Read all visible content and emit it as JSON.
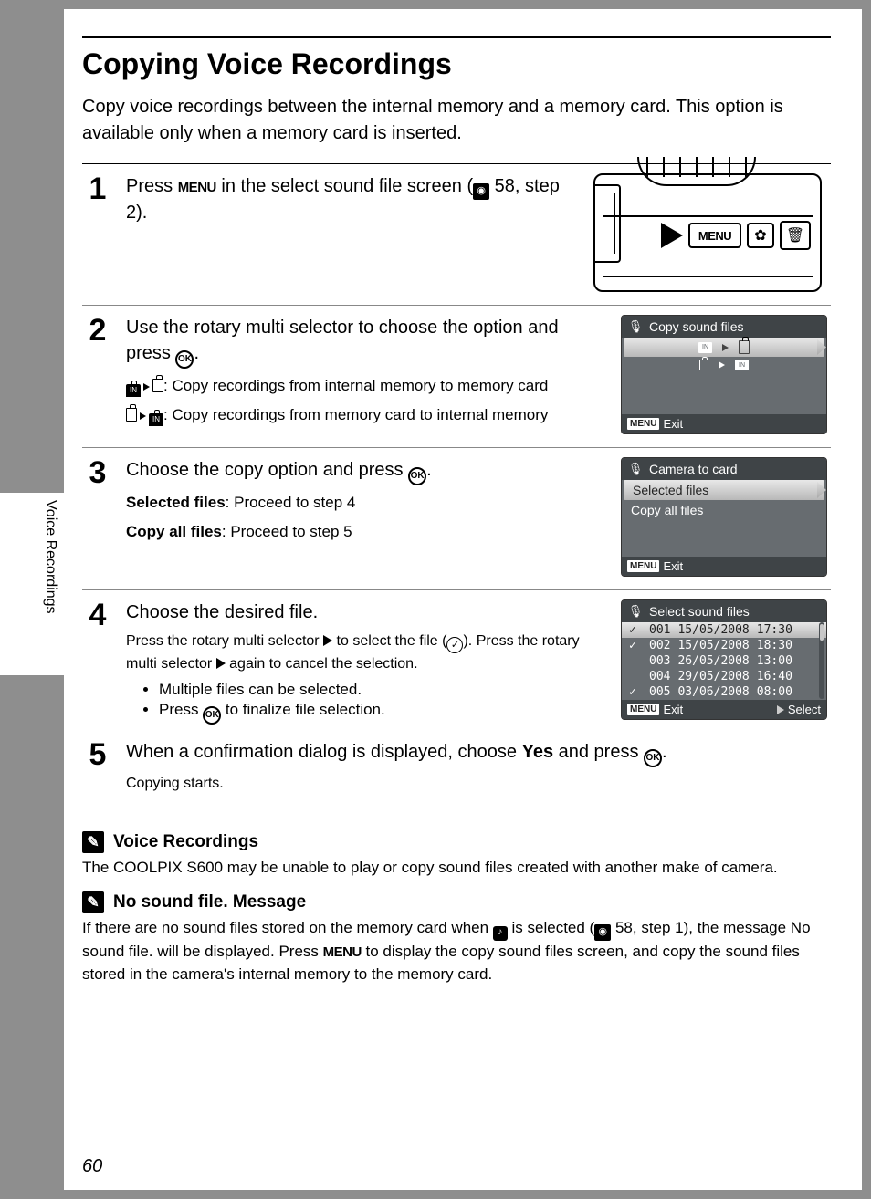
{
  "page_number": "60",
  "side_label": "Voice Recordings",
  "title": "Copying Voice Recordings",
  "intro": "Copy voice recordings between the internal memory and a memory card. This option is available only when a memory card is inserted.",
  "step1": {
    "text_a": "Press ",
    "text_b": " in the select sound file screen (",
    "ref": " 58, step 2).",
    "cam_menu": "MENU"
  },
  "step2": {
    "title_a": "Use the rotary multi selector to choose the option and press ",
    "title_b": ".",
    "sub1": ": Copy recordings from internal memory to memory card",
    "sub2": ": Copy recordings from memory card to internal memory",
    "lcd_title": "Copy sound files",
    "lcd_exit": "Exit"
  },
  "step3": {
    "title_a": "Choose the copy option and press ",
    "title_b": ".",
    "sel_label": "Selected files",
    "sel_text": ": Proceed to step 4",
    "all_label": "Copy all files",
    "all_text": ": Proceed to step 5",
    "lcd_title": "Camera to card",
    "lcd_opt1": "Selected files",
    "lcd_opt2": "Copy all files",
    "lcd_exit": "Exit"
  },
  "step4": {
    "title": "Choose the desired file.",
    "sub_a": "Press the rotary multi selector ",
    "sub_b": " to select the file (",
    "sub_c": "). Press the rotary multi selector ",
    "sub_d": " again to cancel the selection.",
    "bullet1": "Multiple files can be selected.",
    "bullet2_a": "Press ",
    "bullet2_b": " to finalize file selection.",
    "lcd_title": "Select sound files",
    "files": [
      {
        "chk": "✓",
        "n": "001",
        "d": "15/05/2008",
        "t": "17:30",
        "sel": true
      },
      {
        "chk": "✓",
        "n": "002",
        "d": "15/05/2008",
        "t": "18:30",
        "sel": false
      },
      {
        "chk": "",
        "n": "003",
        "d": "26/05/2008",
        "t": "13:00",
        "sel": false
      },
      {
        "chk": "",
        "n": "004",
        "d": "29/05/2008",
        "t": "16:40",
        "sel": false
      },
      {
        "chk": "✓",
        "n": "005",
        "d": "03/06/2008",
        "t": "08:00",
        "sel": false
      }
    ],
    "lcd_exit": "Exit",
    "lcd_select": "Select"
  },
  "step5": {
    "title_a": "When a confirmation dialog is displayed, choose ",
    "title_yes": "Yes",
    "title_b": " and press ",
    "title_c": ".",
    "sub": "Copying starts."
  },
  "note1": {
    "h": "Voice Recordings",
    "t": "The COOLPIX S600 may be unable to play or copy sound files created with another make of camera."
  },
  "note2": {
    "h": "No sound file. Message",
    "t_a": "If there are no sound files stored on the memory card when ",
    "t_b": " is selected (",
    "ref": " 58, step 1), the message ",
    "bold": "No sound file.",
    "t_c": " will be displayed. Press ",
    "t_d": " to display the copy sound files screen, and copy the sound files stored in the camera's internal memory to the memory card."
  }
}
